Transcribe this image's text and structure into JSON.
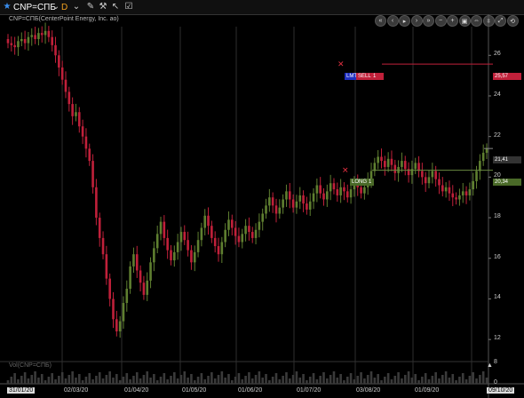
{
  "toolbar": {
    "symbol": "CNP=СПБ",
    "timeframe": "D",
    "icons": [
      "star-icon",
      "chevron-down-icon",
      "pencil-icon",
      "wrench-icon",
      "arrow-cursor-icon",
      "checkbox-icon"
    ]
  },
  "nav_icons": [
    "rewind-icon",
    "back-icon",
    "play-icon",
    "forward-icon",
    "fast-forward-icon",
    "zoom-out-icon",
    "zoom-in-icon",
    "zoom-fit-icon",
    "compress-icon",
    "expand-icon",
    "fit-icon",
    "reset-icon"
  ],
  "chart_title": "CNP=СПБ(CenterPoint Energy, Inc. ао)",
  "volume_title": "Vol(CNP=СПБ)",
  "orders": {
    "sell": {
      "type": "LMT",
      "side": "SELL",
      "qty": "1",
      "price_label": "25,57"
    },
    "long": {
      "side": "LONG",
      "qty": "1",
      "price_label": "20,34"
    },
    "last_price_label": "21,41"
  },
  "colors": {
    "up": "#5f7f30",
    "down": "#c0203a",
    "background": "#000000",
    "grid": "#2a2a2a"
  },
  "chart_data": {
    "type": "candlestick",
    "y_ticks": [
      "12",
      "14",
      "16",
      "18",
      "20",
      "22",
      "24",
      "26"
    ],
    "x_ticks": [
      "31/01/20",
      "02/03/20",
      "01/04/20",
      "01/05/20",
      "01/06/20",
      "01/07/20",
      "03/08/20",
      "01/09/20",
      "09/10/20"
    ],
    "ylim": [
      11,
      27.5
    ],
    "volume_ticks": [
      "0",
      "8"
    ],
    "close_values": [
      26.6,
      26.5,
      26.4,
      26.7,
      26.8,
      26.6,
      26.9,
      27.0,
      26.8,
      27.1,
      27.0,
      27.2,
      26.9,
      26.5,
      26.0,
      25.4,
      24.8,
      24.2,
      23.6,
      23.0,
      23.2,
      22.5,
      22.0,
      21.4,
      20.8,
      19.5,
      18.0,
      17.0,
      16.2,
      15.0,
      14.0,
      13.0,
      12.4,
      12.9,
      13.8,
      14.5,
      15.6,
      16.2,
      15.4,
      14.8,
      14.2,
      14.9,
      15.8,
      16.5,
      17.2,
      17.8,
      17.0,
      16.4,
      15.9,
      16.3,
      16.8,
      17.3,
      16.9,
      16.4,
      15.8,
      16.3,
      16.9,
      17.5,
      18.1,
      17.6,
      17.0,
      16.6,
      16.2,
      16.8,
      17.4,
      17.9,
      17.5,
      17.1,
      16.8,
      17.2,
      17.6,
      17.3,
      17.0,
      17.4,
      17.8,
      18.2,
      18.6,
      19.0,
      18.6,
      18.2,
      18.5,
      18.9,
      19.3,
      18.9,
      18.5,
      18.8,
      19.1,
      18.7,
      18.4,
      18.8,
      19.2,
      19.6,
      19.2,
      18.9,
      19.3,
      19.7,
      19.4,
      19.1,
      19.5,
      19.3,
      19.0,
      19.4,
      19.8,
      19.5,
      19.2,
      19.5,
      19.9,
      20.3,
      20.7,
      21.0,
      20.8,
      20.5,
      20.9,
      20.6,
      20.2,
      20.5,
      20.8,
      20.4,
      20.1,
      20.4,
      20.7,
      20.3,
      20.0,
      19.7,
      20.0,
      20.3,
      19.9,
      19.6,
      19.3,
      19.5,
      19.2,
      19.0,
      18.9,
      19.1,
      19.3,
      19.1,
      19.4,
      19.8,
      20.3,
      20.8,
      21.2,
      21.41
    ]
  }
}
